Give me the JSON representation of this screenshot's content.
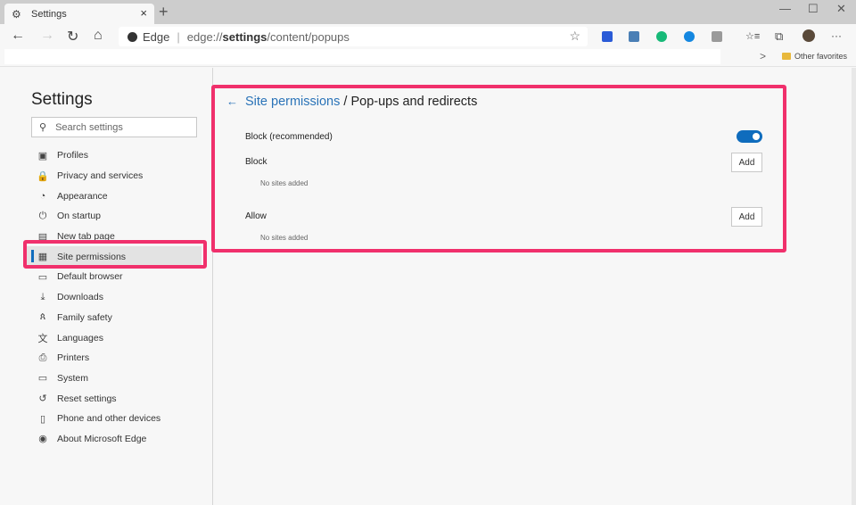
{
  "window": {
    "tab_title": "Settings",
    "tab_icon": "⚙",
    "close_tab": "×",
    "new_tab": "+",
    "minimize": "—",
    "maximize": "☐",
    "close": "✕"
  },
  "toolbar": {
    "back": "←",
    "forward": "→",
    "refresh": "↻",
    "home": "⌂",
    "site_label": "Edge",
    "separator": "|",
    "url_prefix": "edge://",
    "url_bold": "settings",
    "url_suffix": "/content/popups",
    "favorite_star": "☆",
    "favorites_icon": "☆≡",
    "collections_icon": "⧉",
    "more": "···"
  },
  "extensions_colors": [
    "#2a5bd7",
    "#4a7fb5",
    "#17b978",
    "#1487e0",
    "#9a9a9a"
  ],
  "favorites_bar": {
    "chevron": ">",
    "other_favorites": "Other favorites"
  },
  "sidebar": {
    "title": "Settings",
    "search_placeholder": "Search settings",
    "items": [
      {
        "label": "Profiles",
        "icon": "▣"
      },
      {
        "label": "Privacy and services",
        "icon": "🔒"
      },
      {
        "label": "Appearance",
        "icon": "◔"
      },
      {
        "label": "On startup",
        "icon": "⏻"
      },
      {
        "label": "New tab page",
        "icon": "▤"
      },
      {
        "label": "Site permissions",
        "icon": "▦",
        "active": true
      },
      {
        "label": "Default browser",
        "icon": "▭"
      },
      {
        "label": "Downloads",
        "icon": "⤓"
      },
      {
        "label": "Family safety",
        "icon": "ጰ"
      },
      {
        "label": "Languages",
        "icon": "文"
      },
      {
        "label": "Printers",
        "icon": "⎙"
      },
      {
        "label": "System",
        "icon": "▭"
      },
      {
        "label": "Reset settings",
        "icon": "↺"
      },
      {
        "label": "Phone and other devices",
        "icon": "▯"
      },
      {
        "label": "About Microsoft Edge",
        "icon": "◉"
      }
    ]
  },
  "main": {
    "back_arrow": "←",
    "breadcrumb_link": "Site permissions",
    "breadcrumb_rest": " / Pop-ups and redirects",
    "block_recommended_label": "Block (recommended)",
    "block_recommended_on": true,
    "block_label": "Block",
    "block_empty": "No sites added",
    "allow_label": "Allow",
    "allow_empty": "No sites added",
    "add_label": "Add"
  }
}
